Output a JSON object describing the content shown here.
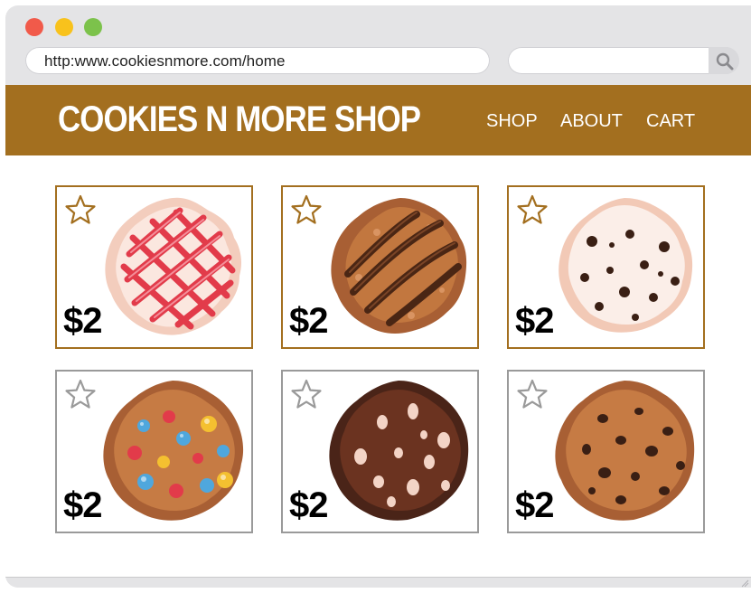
{
  "browser": {
    "url": "http:www.cookiesnmore.com/home",
    "search_value": ""
  },
  "site": {
    "title": "COOKIES N MORE SHOP",
    "nav": [
      "SHOP",
      "ABOUT",
      "CART"
    ],
    "header_color": "#a36f1f"
  },
  "products": [
    {
      "price": "$2",
      "kind": "frosted-lattice-cookie-icon",
      "favorited_highlight": true
    },
    {
      "price": "$2",
      "kind": "chocolate-drizzle-cookie-icon",
      "favorited_highlight": true
    },
    {
      "price": "$2",
      "kind": "white-chip-cookie-icon",
      "favorited_highlight": true
    },
    {
      "price": "$2",
      "kind": "candy-cookie-icon",
      "favorited_highlight": false
    },
    {
      "price": "$2",
      "kind": "double-chocolate-cookie-icon",
      "favorited_highlight": false
    },
    {
      "price": "$2",
      "kind": "chocolate-chip-cookie-icon",
      "favorited_highlight": false
    }
  ]
}
